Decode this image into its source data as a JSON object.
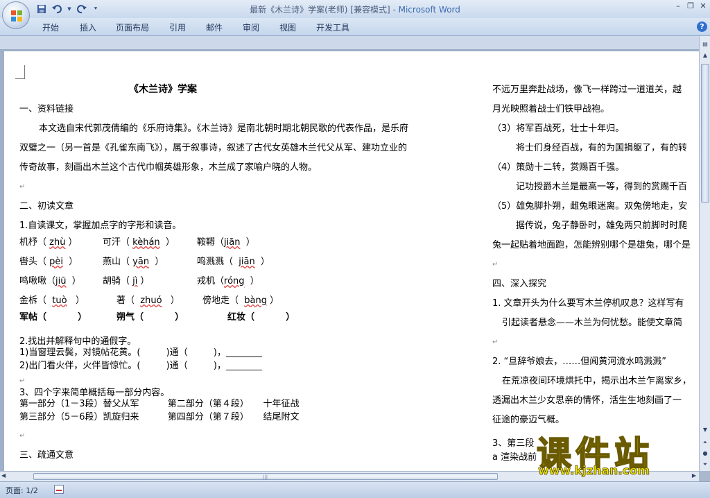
{
  "window": {
    "title_doc": "最新《木兰诗》学案(老师) [兼容模式]",
    "title_sep": " - ",
    "title_app": "Microsoft Word"
  },
  "quick_access": {
    "icons": [
      "save-icon",
      "undo-icon",
      "redo-icon",
      "customize-icon"
    ]
  },
  "window_controls": {
    "minimize": "–",
    "restore": "❐",
    "close": "✕"
  },
  "ribbon": {
    "tabs": [
      "开始",
      "插入",
      "页面布局",
      "引用",
      "邮件",
      "审阅",
      "视图",
      "开发工具"
    ],
    "help": "?"
  },
  "document": {
    "left": {
      "title": "《木兰诗》学案",
      "s1": "一、资料链接",
      "p1a": "本文选自宋代郭茂倩编的《乐府诗集》。《木兰诗》是南北朝时期北朝民歌的代表作品，是乐府",
      "p1b": "双璧之一（另一首是《孔雀东南飞》），属于叙事诗，叙述了古代女英雄木兰代父从军、建功立业的",
      "p1c": "传奇故事，刻画出木兰这个古代巾帼英雄形象，木兰成了家喻户晓的人物。",
      "s2": "二、初读文章",
      "q1": "1.自读课文，掌握加点字的字形和读音。",
      "r1": [
        {
          "w": "机杼（",
          "p": "zhù",
          "e": "）"
        },
        {
          "w": "可汗（",
          "p": "kèhán",
          "e": "）"
        },
        {
          "w": "鞍鞯（",
          "p": "jiān",
          "e": "）"
        }
      ],
      "r2": [
        {
          "w": "辔头（",
          "p": "pèi",
          "e": "）"
        },
        {
          "w": "燕山（",
          "p": "yān",
          "e": "）"
        },
        {
          "w": "鸣溅溅（",
          "p": "jiān",
          "e": "）"
        }
      ],
      "r3": [
        {
          "w": "鸣啾啾（",
          "p": "jiū",
          "e": "）"
        },
        {
          "w": "胡骑（",
          "p": "jì",
          "e": "）"
        },
        {
          "w": "戎机（",
          "p": "róng",
          "e": "）"
        }
      ],
      "r4": [
        {
          "w": "金柝（",
          "p": "tuò",
          "e": "）"
        },
        {
          "w": "著（",
          "p": "zhuó",
          "e": "）"
        },
        {
          "w": "傍地走（",
          "p": "bàng",
          "e": "）"
        }
      ],
      "r5": [
        {
          "w": "军帖（",
          "e": "）"
        },
        {
          "w": "朔气（",
          "e": "）"
        },
        {
          "w": "红妆（",
          "e": "）"
        }
      ],
      "q2": "2.找出并解释句中的通假字。",
      "q2a": "1)当窗理云鬓，对镜帖花黄。(         )通（         )，________",
      "q2b": "2)出门看火伴，火伴皆惊忙。(         )通（         )，________",
      "q3": "3、四个字来简单概括每一部分内容。",
      "q3a": "第一部分（1－3段）替父从军          第二部分（第４段）     十年征战",
      "q3b": "第三部分（5－6段）凯旋归来          第四部分（第７段）     结尾附文",
      "s3": "三、疏通文意"
    },
    "right": {
      "l1": "不远万里奔赴战场，像飞一样跨过一道道关，越",
      "l2": "月光映照着战士们铁甲战袍。",
      "l3": "（3）将军百战死，壮士十年归。",
      "l4": "将士们身经百战，有的为国捐躯了，有的转",
      "l5": "（4）策勋十二转，赏赐百千强。",
      "l6": "记功授爵木兰是最高一等，得到的赏赐千百",
      "l7": "（5）雄兔脚扑朔，雌兔眼迷离。双兔傍地走，安",
      "l8": "据传说，兔子静卧时，雄兔两只前脚时时爬",
      "l9": "兔一起贴着地面跑，怎能辨别哪个是雄兔，哪个是",
      "s4": "四、深入探究",
      "q1": "1. 文章开头为什么要写木兰停机叹息？这样写有",
      "a1": "引起读者悬念——木兰为何忧愁。能使文章简",
      "q2": "2. “旦辞爷娘去，……但闻黄河流水鸣溅溅”",
      "a2a": "在荒凉夜间环境烘托中，揭示出木兰乍离家乡，",
      "a2b": "透漏出木兰少女思亲的情怀，活生生地刻画了一",
      "a2c": "征途的豪迈气概。",
      "q3": "3、第三段",
      "a3": "a 渲染战前"
    }
  },
  "status_bar": {
    "page": "页面: 1/2"
  },
  "watermark": {
    "title": "课件站",
    "url": "www.kjzhan.com"
  },
  "colors": {
    "ribbon": "#c4d6ec",
    "accent": "#3b6bb0",
    "watermark": "#f5e500"
  }
}
